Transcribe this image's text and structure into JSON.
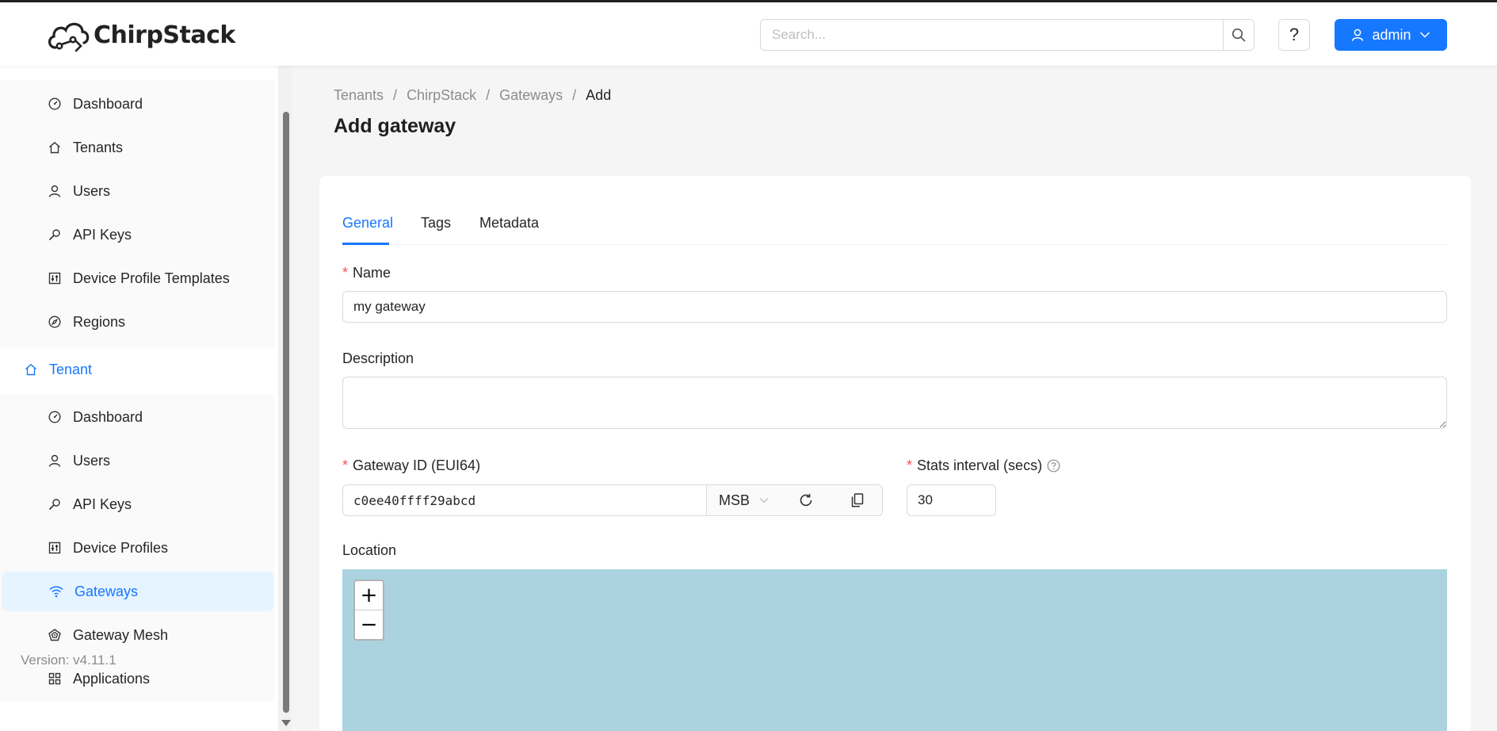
{
  "app": {
    "logo_text": "ChirpStack"
  },
  "header": {
    "search_placeholder": "Search...",
    "help_label": "?",
    "user_label": "admin"
  },
  "sidebar": {
    "admin_items": [
      {
        "label": "Dashboard",
        "icon": "dashboard-icon"
      },
      {
        "label": "Tenants",
        "icon": "home-icon"
      },
      {
        "label": "Users",
        "icon": "user-icon"
      },
      {
        "label": "API Keys",
        "icon": "key-icon"
      },
      {
        "label": "Device Profile Templates",
        "icon": "control-icon"
      },
      {
        "label": "Regions",
        "icon": "compass-icon"
      }
    ],
    "tenant_group": {
      "label": "Tenant",
      "icon": "home-icon"
    },
    "tenant_items": [
      {
        "label": "Dashboard",
        "icon": "dashboard-icon"
      },
      {
        "label": "Users",
        "icon": "user-icon"
      },
      {
        "label": "API Keys",
        "icon": "key-icon"
      },
      {
        "label": "Device Profiles",
        "icon": "control-icon"
      },
      {
        "label": "Gateways",
        "icon": "wifi-icon",
        "selected": true
      },
      {
        "label": "Gateway Mesh",
        "icon": "radar-icon"
      },
      {
        "label": "Applications",
        "icon": "appstore-icon"
      }
    ],
    "version": "Version: v4.11.1"
  },
  "breadcrumb": {
    "items": [
      "Tenants",
      "ChirpStack",
      "Gateways",
      "Add"
    ],
    "separator": "/"
  },
  "page": {
    "title": "Add gateway"
  },
  "tabs": [
    {
      "label": "General",
      "active": true
    },
    {
      "label": "Tags",
      "active": false
    },
    {
      "label": "Metadata",
      "active": false
    }
  ],
  "form": {
    "name_label": "Name",
    "name_value": "my gateway",
    "description_label": "Description",
    "description_value": "",
    "gateway_id_label": "Gateway ID (EUI64)",
    "gateway_id_value": "c0ee40ffff29abcd",
    "byte_order": "MSB",
    "stats_interval_label": "Stats interval (secs)",
    "stats_interval_value": "30",
    "location_label": "Location",
    "required_mark": "*"
  },
  "map": {
    "zoom_in": "+",
    "zoom_out": "−",
    "water_color": "#aad3df"
  },
  "colors": {
    "accent": "#1677ff",
    "required": "#ff4d4f",
    "selected_bg": "#e6f4ff"
  }
}
